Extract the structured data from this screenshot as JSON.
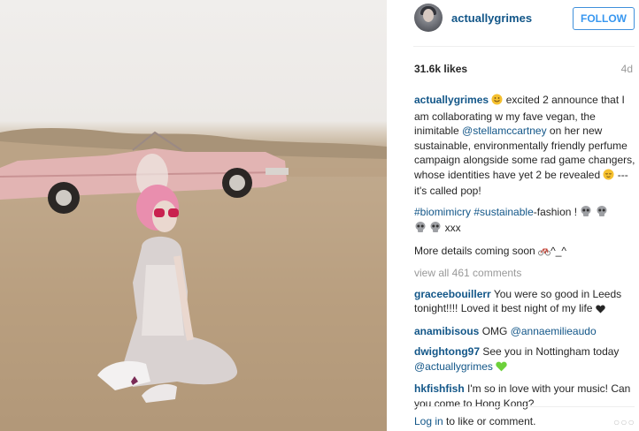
{
  "post": {
    "username": "actuallygrimes",
    "follow_label": "FOLLOW",
    "likes": "31.6k likes",
    "age": "4d"
  },
  "caption": {
    "author": "actuallygrimes",
    "text1": " excited 2 announce that I am collaborating w my fave vegan, the inimitable ",
    "mention": "@stellamccartney",
    "text2": " on her new sustainable, environmentally friendly perfume campaign alongside some rad game changers, whose identities have yet 2 be revealed ",
    "text3": " --- it's called pop!",
    "tag1": "#biomimicry",
    "tag2": "#sustainable",
    "tag_suffix": "-fashion ! ",
    "xxx": " xxx",
    "more": "More details coming soon ",
    "more_end": "^_^"
  },
  "comments": {
    "view_all": "view all 461 comments",
    "items": [
      {
        "user": "graceebouillerr",
        "text": " You were so good in Leeds tonight!!!! Loved it best night of my life "
      },
      {
        "user": "anamibisous",
        "text": " OMG ",
        "mention": "@annaemilieaudo"
      },
      {
        "user": "dwightong97",
        "text": " See you in Nottingham today ",
        "mention": "@actuallygrimes"
      },
      {
        "user": "hkfishfish",
        "text": " I'm so in love with your music! Can you come to Hong Kong?"
      }
    ]
  },
  "footer": {
    "login": "Log in",
    "rest": " to like or comment.",
    "more": "○○○"
  },
  "icons": [
    "smile-emoji-icon",
    "relieved-emoji-icon",
    "skull-emoji-icon",
    "heart-icon",
    "green-heart-icon",
    "bicycle-emoji-icon",
    "more-options-icon"
  ]
}
